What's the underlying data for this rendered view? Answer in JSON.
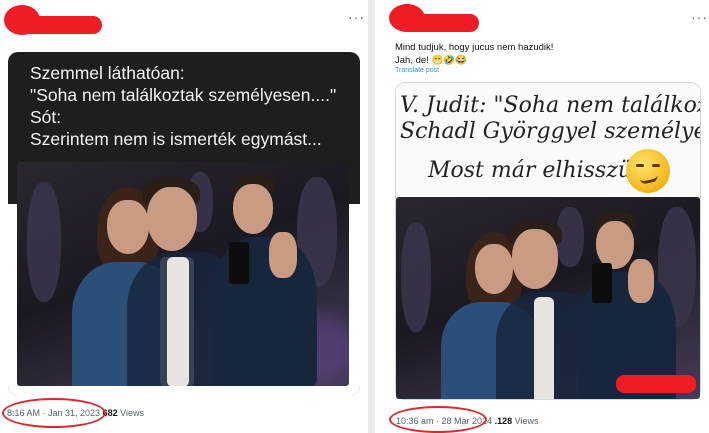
{
  "left_post": {
    "more_label": "···",
    "card_lines": "Szemmel láthatóan:\n\"Soha nem találkoztak személyesen....\"\nSót:\nSzerintem nem is ismerték egymást...",
    "timestamp": "8:16 AM · Jan 31, 2023",
    "views_count": "682",
    "views_label": "Views"
  },
  "right_post": {
    "more_label": "···",
    "text_line1": "Mind tudjuk, hogy jucus nem hazudik!",
    "text_line2": "Jah, de! 😁🤣😂",
    "translate_label": "Translate post",
    "image_caption_line1": "V. Judit: \"Soha nem találkoztam\nSchadl Györggyel személyesen!\"",
    "image_caption_line2": "Most már elhisszük...",
    "timestamp": "10:36 am · 28 Mar 2024",
    "views_count": ".128",
    "views_label": "Views"
  },
  "colors": {
    "redaction": "#ee1c24",
    "circle_mark": "#e0262c",
    "link": "#1d9bf0"
  }
}
